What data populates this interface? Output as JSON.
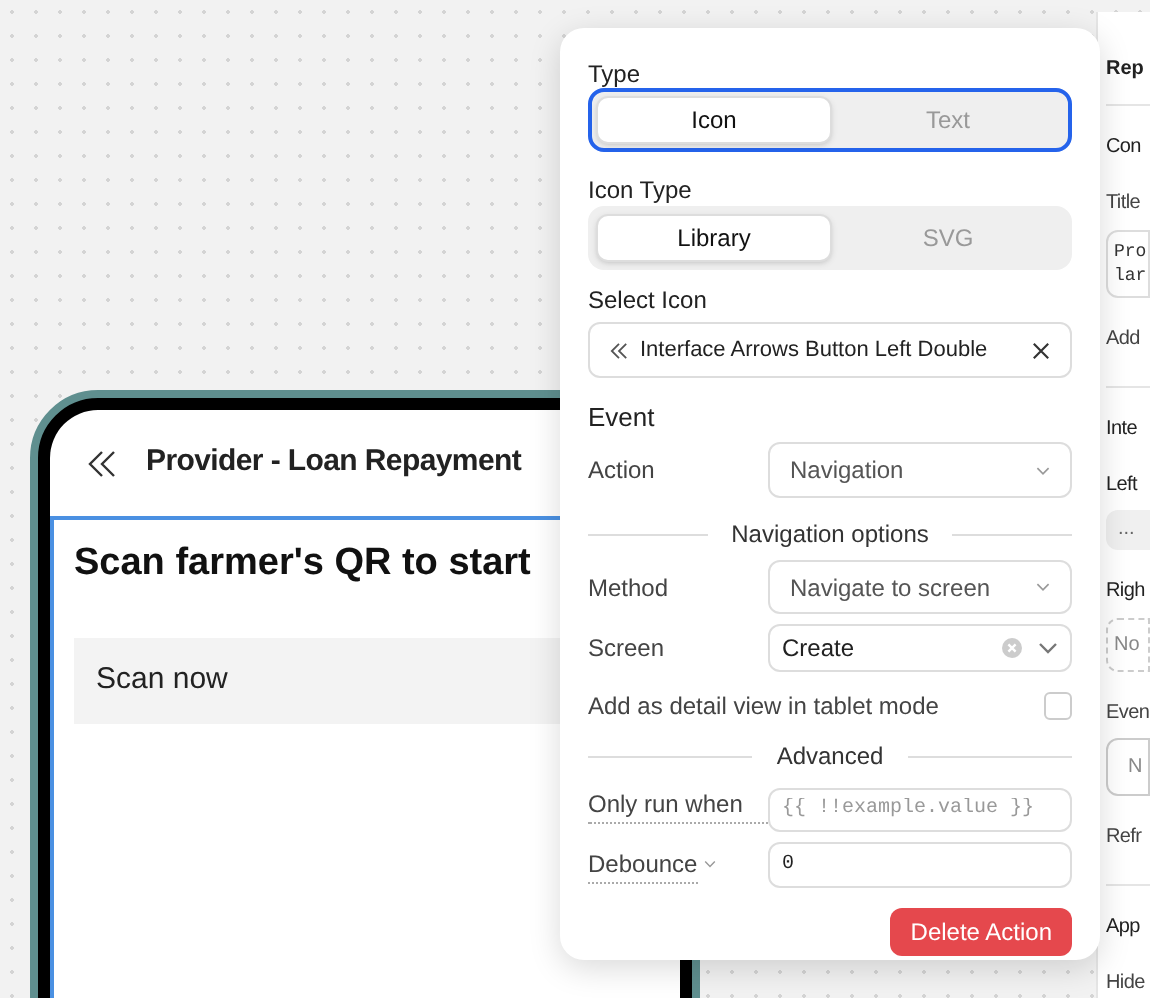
{
  "phone": {
    "title": "Provider - Loan Repayment",
    "heading": "Scan farmer's QR to start",
    "button": "Scan now"
  },
  "popover": {
    "type": {
      "label": "Type",
      "options": [
        {
          "label": "Icon",
          "selected": true
        },
        {
          "label": "Text",
          "selected": false
        }
      ]
    },
    "icon_type": {
      "label": "Icon Type",
      "options": [
        {
          "label": "Library",
          "selected": true
        },
        {
          "label": "SVG",
          "selected": false
        }
      ]
    },
    "select_icon": {
      "label": "Select Icon",
      "value": "Interface Arrows Button Left Double"
    },
    "event": {
      "title": "Event",
      "label": "Action",
      "value": "Navigation"
    },
    "navigation_options": "Navigation options",
    "method": {
      "label": "Method",
      "value": "Navigate to screen"
    },
    "screen": {
      "label": "Screen",
      "value": "Create"
    },
    "detail_view": {
      "label": "Add as detail view in tablet mode",
      "checked": false
    },
    "advanced": "Advanced",
    "only_run_when": {
      "label": "Only run when",
      "placeholder": "{{ !!example.value }}"
    },
    "debounce": {
      "label": "Debounce",
      "value": "0"
    },
    "delete_button": "Delete Action"
  },
  "sidebar": {
    "items": [
      {
        "kind": "header",
        "text": "Rep"
      },
      {
        "kind": "section",
        "text": "Con"
      },
      {
        "kind": "label",
        "text": "Title"
      },
      {
        "kind": "code",
        "lines": [
          "Pro",
          "lar"
        ]
      },
      {
        "kind": "label",
        "text": "Add"
      },
      {
        "kind": "divider"
      },
      {
        "kind": "section",
        "text": "Inte"
      },
      {
        "kind": "section",
        "text": "Left"
      },
      {
        "kind": "field",
        "text": "..."
      },
      {
        "kind": "section",
        "text": "Righ"
      },
      {
        "kind": "dashed",
        "text": "No"
      },
      {
        "kind": "label",
        "text": "Even"
      },
      {
        "kind": "area",
        "text": "N"
      },
      {
        "kind": "label",
        "text": "Refr"
      },
      {
        "kind": "divider"
      },
      {
        "kind": "section",
        "text": "App"
      },
      {
        "kind": "label",
        "text": "Hide"
      }
    ]
  }
}
